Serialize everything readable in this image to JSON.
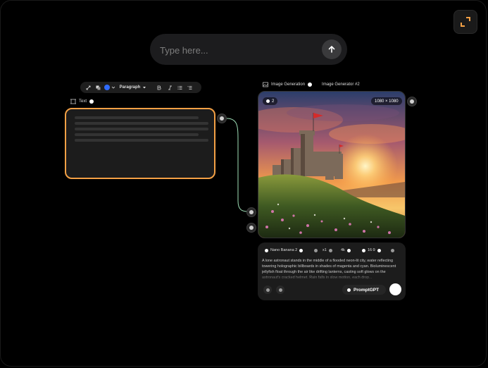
{
  "prompt": {
    "placeholder": "Type here..."
  },
  "toolbar": {
    "style_label": "Paragraph",
    "color": "#2f6bff"
  },
  "text_node": {
    "label": "Text"
  },
  "image_node": {
    "type_label": "Image Generation",
    "name": "Image Generator #2",
    "count_badge": "2",
    "resolution_badge": "1080 × 1080"
  },
  "generator": {
    "model": "Nano Banana 2",
    "multiplier": "x1",
    "quality": "4k",
    "aspect": "16:9",
    "description": "A lone astronaut stands in the middle of a flooded neon-lit city, water reflecting towering holographic billboards in shades of magenta and cyan. Bioluminescent jellyfish float through the air like drifting lanterns, casting soft glows on the astronaut's cracked helmet. Rain falls in slow motion, each drop...",
    "enhancer": "PromptGPT"
  },
  "colors": {
    "accent": "#f3a045",
    "background": "#000000",
    "card": "#1c1c1c"
  }
}
